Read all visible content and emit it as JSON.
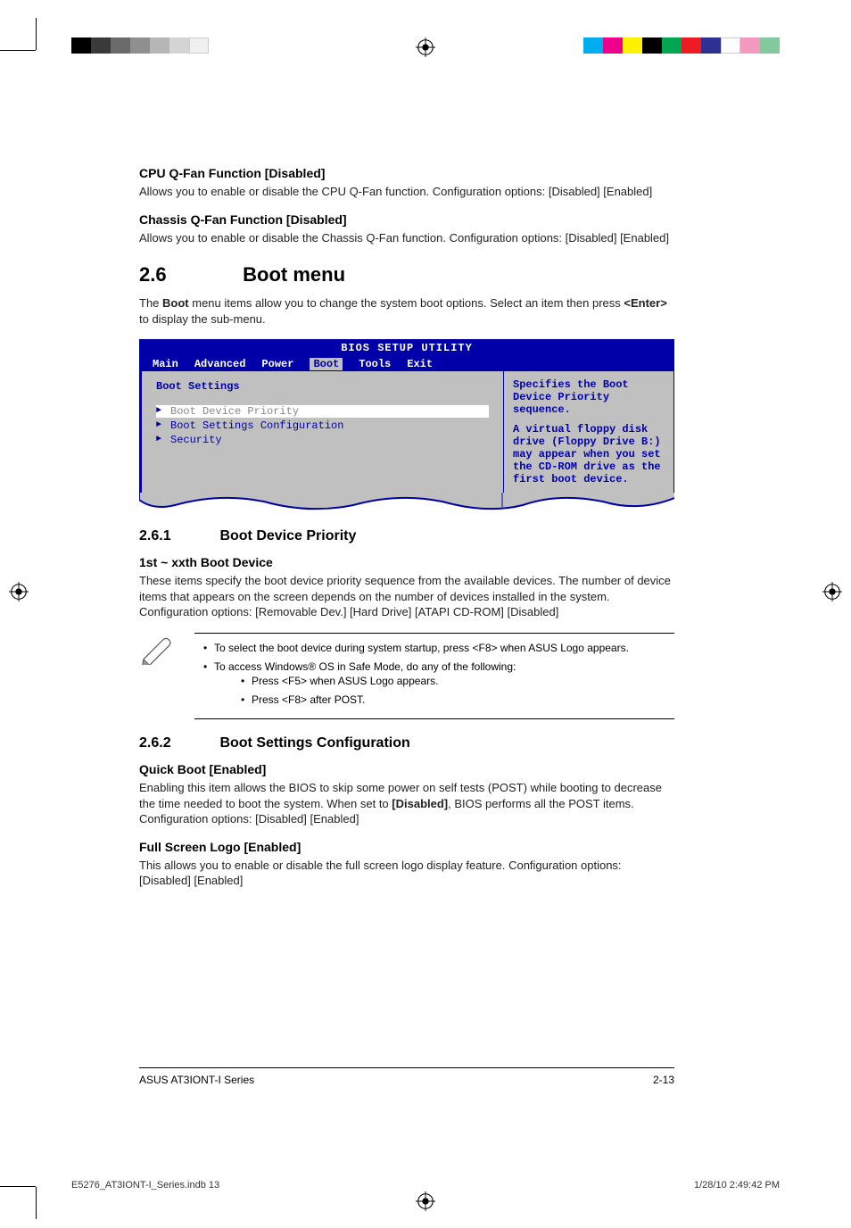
{
  "print": {
    "imposition_file": "E5276_AT3IONT-I_Series.indb   13",
    "imposition_date": "1/28/10   2:49:42 PM"
  },
  "sections": {
    "cpu_qfan": {
      "title": "CPU Q-Fan Function [Disabled]",
      "body": "Allows you to enable or disable the CPU Q-Fan function. Configuration options: [Disabled] [Enabled]"
    },
    "chassis_qfan": {
      "title": "Chassis Q-Fan Function [Disabled]",
      "body": "Allows you to enable or disable the Chassis Q-Fan function. Configuration options: [Disabled] [Enabled]"
    },
    "boot_menu": {
      "num": "2.6",
      "title": "Boot menu",
      "intro_pre": "The ",
      "intro_bold1": "Boot",
      "intro_mid": " menu items allow you to change the system boot options. Select an item then press ",
      "intro_bold2": "<Enter>",
      "intro_post": " to display the sub-menu."
    },
    "boot_priority": {
      "num": "2.6.1",
      "title": "Boot Device Priority",
      "sub_title": "1st ~ xxth Boot Device",
      "body": "These items specify the boot device priority sequence from the available devices. The number of device items that appears on the screen depends on the number of devices installed in the system. Configuration options: [Removable Dev.] [Hard Drive] [ATAPI CD-ROM] [Disabled]"
    },
    "boot_settings": {
      "num": "2.6.2",
      "title": "Boot Settings Configuration",
      "quick_title": "Quick Boot [Enabled]",
      "quick_body_pre": "Enabling this item allows the BIOS to skip some power on self tests (POST) while booting to decrease the time needed to boot the system. When set to ",
      "quick_body_bold": "[Disabled]",
      "quick_body_post": ", BIOS performs all the POST items. Configuration options: [Disabled] [Enabled]",
      "logo_title": "Full Screen Logo [Enabled]",
      "logo_body": "This allows you to enable or disable the full screen logo display feature. Configuration options: [Disabled] [Enabled]"
    }
  },
  "bios": {
    "title": "BIOS SETUP UTILITY",
    "menu": [
      "Main",
      "Advanced",
      "Power",
      "Boot",
      "Tools",
      "Exit"
    ],
    "selected_menu": "Boot",
    "heading": "Boot Settings",
    "items": [
      "Boot Device Priority",
      "Boot Settings Configuration",
      "Security"
    ],
    "selected_item": "Boot Device Priority",
    "help1": "Specifies the Boot Device Priority sequence.",
    "help2": "A virtual floppy disk drive (Floppy Drive B:) may appear when you set the CD-ROM drive as the first boot device."
  },
  "note": {
    "li1": "To select the boot device during system startup, press <F8> when ASUS Logo appears.",
    "li2": "To access Windows® OS in Safe Mode, do any of the following:",
    "li2a": "Press <F5> when ASUS Logo appears.",
    "li2b": "Press <F8> after POST."
  },
  "footer": {
    "left": "ASUS AT3IONT-I Series",
    "right": "2-13"
  },
  "colors": {
    "left_strip": [
      "#000",
      "#3a3a3a",
      "#6b6b6b",
      "#8f8f8f",
      "#b5b5b5",
      "#d4d4d4",
      "#f0f0f0"
    ],
    "right_strip": [
      "#00AEEF",
      "#EC008C",
      "#FFF200",
      "#000",
      "#00A651",
      "#ED1C24",
      "#2E3192",
      "#fff",
      "#F49AC1",
      "#82CA9C",
      "#FFF"
    ]
  }
}
